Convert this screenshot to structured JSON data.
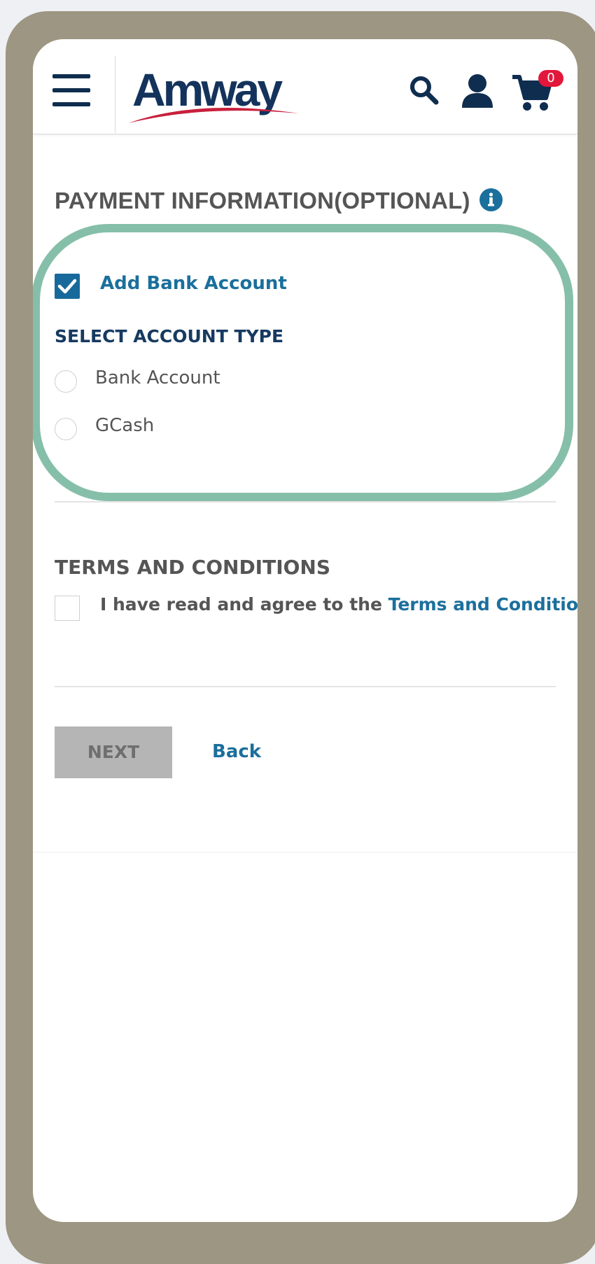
{
  "header": {
    "logo_text": "Amway",
    "cart_count": "0",
    "colors": {
      "brand_navy": "#14335c",
      "badge": "#e3173b",
      "link_blue": "#1b6f9c"
    }
  },
  "payment": {
    "title": "PAYMENT INFORMATION(OPTIONAL)",
    "add_bank_label": "Add Bank Account",
    "add_bank_checked": true,
    "account_type_title": "SELECT ACCOUNT TYPE",
    "options": [
      {
        "label": "Bank Account",
        "selected": false
      },
      {
        "label": "GCash",
        "selected": false
      }
    ]
  },
  "terms": {
    "title": "TERMS AND CONDITIONS",
    "agree_text": "I have read and agree to the ",
    "link_text": "Terms and Conditions",
    "checked": false
  },
  "actions": {
    "next_label": "NEXT",
    "back_label": "Back"
  },
  "annotation": {
    "highlight_color": "#86bfa9"
  }
}
